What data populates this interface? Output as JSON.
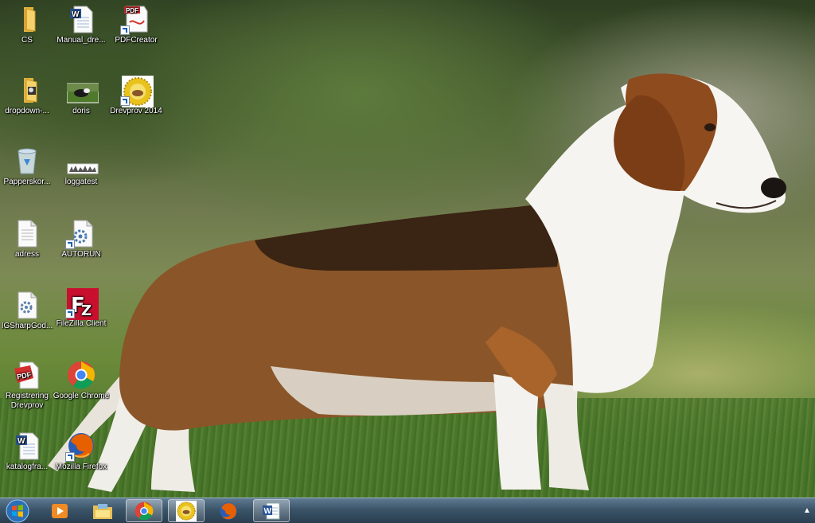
{
  "desktop": {
    "icons": [
      {
        "label": "CS",
        "icon": "folder-icon"
      },
      {
        "label": "Manual_dre...",
        "icon": "word-document-icon"
      },
      {
        "label": "PDFCreator",
        "icon": "pdfcreator-icon"
      },
      {
        "label": "dropdown-...",
        "icon": "folder-image-icon"
      },
      {
        "label": "doris",
        "icon": "photo-thumbnail-icon"
      },
      {
        "label": "Drevprov 2014",
        "icon": "drevprov-logo-icon"
      },
      {
        "label": "Papperskor...",
        "icon": "recycle-bin-icon"
      },
      {
        "label": "loggatest",
        "icon": "logo-thumbnail-icon"
      },
      {
        "label": "adress",
        "icon": "text-document-icon"
      },
      {
        "label": "AUTORUN",
        "icon": "settings-file-icon"
      },
      {
        "label": "IGSharpGod...",
        "icon": "settings-file-icon"
      },
      {
        "label": "FileZilla Client",
        "icon": "filezilla-icon"
      },
      {
        "label": "Registrering Drevprov",
        "icon": "pdf-icon"
      },
      {
        "label": "Google Chrome",
        "icon": "chrome-icon"
      },
      {
        "label": "katalogfra...",
        "icon": "word-document-icon"
      },
      {
        "label": "Mozilla Firefox",
        "icon": "firefox-icon"
      }
    ]
  },
  "taskbar": {
    "start": "windows-start-orb-icon",
    "items": [
      {
        "icon": "media-player-icon",
        "active": false
      },
      {
        "icon": "file-explorer-icon",
        "active": false
      },
      {
        "icon": "chrome-icon",
        "active": true
      },
      {
        "icon": "drevprov-logo-icon",
        "active": true
      },
      {
        "icon": "firefox-icon",
        "active": false
      },
      {
        "icon": "word-icon",
        "active": true
      }
    ],
    "tray_arrow": "▲"
  },
  "colors": {
    "taskbar_top": "#5e7a92",
    "taskbar_bottom": "#2a3e50",
    "pdf_red": "#d32f2f",
    "filezilla_red": "#c8102e"
  }
}
